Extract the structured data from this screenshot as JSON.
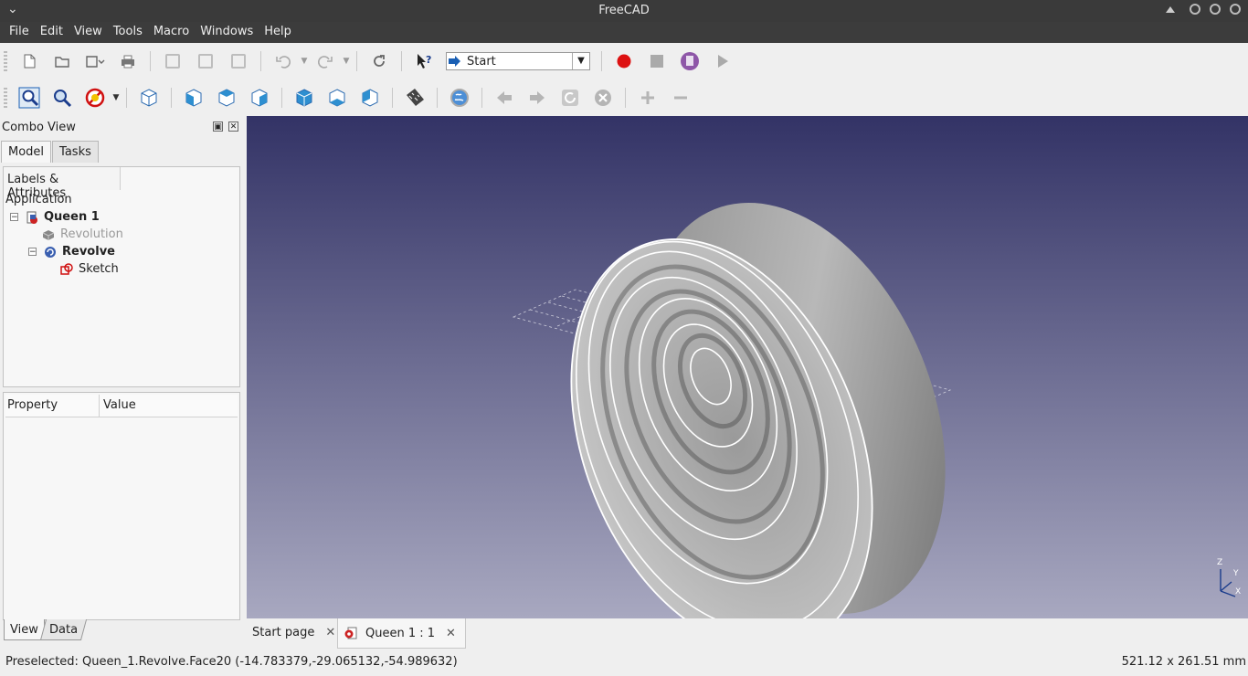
{
  "window": {
    "title": "FreeCAD"
  },
  "menu": [
    "File",
    "Edit",
    "View",
    "Tools",
    "Macro",
    "Windows",
    "Help"
  ],
  "toolbar": {
    "workbench": "Start"
  },
  "combo": {
    "title": "Combo View",
    "tabs": [
      "Model",
      "Tasks"
    ],
    "tree_header": "Labels & Attributes",
    "tree": [
      {
        "label": "Application"
      },
      {
        "label": "Queen 1"
      },
      {
        "label": "Revolution"
      },
      {
        "label": "Revolve"
      },
      {
        "label": "Sketch"
      }
    ],
    "props_columns": [
      "Property",
      "Value"
    ],
    "bottom_tabs": [
      "View",
      "Data"
    ]
  },
  "axis": {
    "z": "Z",
    "y": "Y",
    "x": "X"
  },
  "doc_tabs": [
    "Start page",
    "Queen 1 : 1"
  ],
  "status": {
    "preselected": "Preselected: Queen_1.Revolve.Face20 (-14.783379,-29.065132,-54.989632)",
    "dimensions": "521.12 x 261.51 mm"
  },
  "colors": {
    "viewport_top": "#333366",
    "viewport_bottom": "#a8a8c0",
    "record": "#dd1111",
    "accent": "#1a5fb4"
  }
}
